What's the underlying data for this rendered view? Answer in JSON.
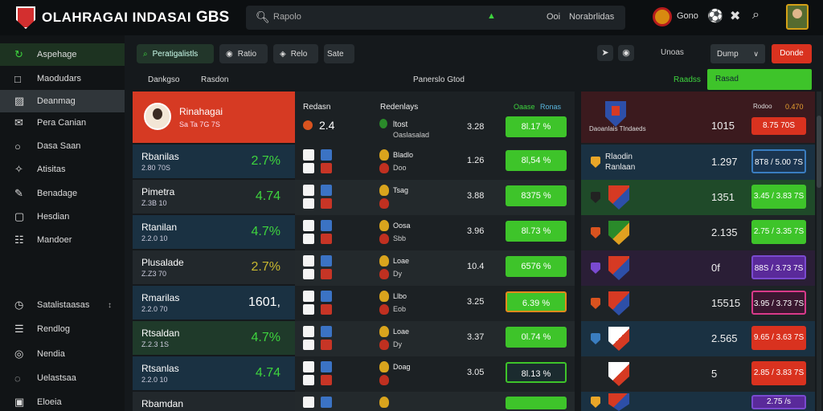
{
  "topbar": {
    "title": "OLAHRAGAI INDASAI",
    "brand_suffix": "GBS",
    "search_placeholder": "Rapolo",
    "search_right_1": "Ooi",
    "search_right_2": "Norabrlidas",
    "game_label": "Gono"
  },
  "sidebar": {
    "items": [
      {
        "label": "Aspehage",
        "icon": "refresh-icon"
      },
      {
        "label": "Maodudars",
        "icon": "square-icon"
      },
      {
        "label": "Deanmag",
        "icon": "image-icon"
      },
      {
        "label": "Pera Canian",
        "icon": "message-icon"
      },
      {
        "label": "Dasa Saan",
        "icon": "chat-icon"
      },
      {
        "label": "Atisitas",
        "icon": "shield-icon"
      },
      {
        "label": "Benadage",
        "icon": "pen-icon"
      },
      {
        "label": "Hesdian",
        "icon": "box-icon"
      },
      {
        "label": "Mandoer",
        "icon": "grid-icon"
      },
      {
        "label": "Satalistaasas",
        "icon": "clock-icon"
      },
      {
        "label": "Rendlog",
        "icon": "list-icon"
      },
      {
        "label": "Nendia",
        "icon": "target-icon"
      },
      {
        "label": "Uelastsaa",
        "icon": "globe-icon"
      },
      {
        "label": "Eloeia",
        "icon": "square-icon"
      }
    ]
  },
  "toolbar": {
    "filter1": "Peratigalistls",
    "filter2": "Ratio",
    "filter3": "Relo",
    "filter4": "Sate",
    "mark": "Unoas",
    "dropdown": "Dump",
    "red_button": "Donde",
    "col_a": "Dankgso",
    "col_b": "Rasdon",
    "col_c": "Panerslo Gtod",
    "green_label": "Raadss",
    "green_bar": "Rasad"
  },
  "players": {
    "header": {
      "name": "Rinahagai",
      "sub": "Sa Ta 7G 7S"
    },
    "rows": [
      {
        "name": "Rbanilas",
        "sub": "2.80 70S",
        "val": "2.7%",
        "style": "g"
      },
      {
        "name": "Pimetra",
        "sub": "Z.3B 10",
        "val": "4.74",
        "style": "g"
      },
      {
        "name": "Rtanilan",
        "sub": "2.2.0 10",
        "val": "4.7%",
        "style": "g"
      },
      {
        "name": "Plusalade",
        "sub": "Z.Z3 70",
        "val": "2.7%",
        "style": "y"
      },
      {
        "name": "Rmarilas",
        "sub": "2.2.0 70",
        "val": "1601,",
        "style": "w"
      },
      {
        "name": "Rtsaldan",
        "sub": "Z.2.3 1S",
        "val": "4.7%",
        "style": "g"
      },
      {
        "name": "Rtsanlas",
        "sub": "2.2.0 10",
        "val": "4.74",
        "style": "g"
      },
      {
        "name": "Rbamdan",
        "sub": "",
        "val": "",
        "style": "w"
      }
    ]
  },
  "matches": {
    "header": {
      "col1": "Redasn",
      "col2": "Redenlays",
      "tag1": "Oaase",
      "tag2": "Ronas",
      "score": "2.4",
      "opp1": "ltost",
      "opp2": "Oaslasalad",
      "num": "3.28",
      "odd": "8l.17 %"
    },
    "rows": [
      {
        "t1": "Bladlo",
        "t2": "Doo",
        "num": "1.26",
        "odd": "8l,54 %",
        "style": ""
      },
      {
        "t1": "Tsag",
        "t2": "",
        "num": "3.88",
        "odd": "8375 %",
        "style": ""
      },
      {
        "t1": "Oosa",
        "t2": "Sbb",
        "num": "3.96",
        "odd": "8l.73 %",
        "style": ""
      },
      {
        "t1": "Loae",
        "t2": "Dy",
        "num": "10.4",
        "odd": "6576 %",
        "style": ""
      },
      {
        "t1": "Llbo",
        "t2": "Eob",
        "num": "3.25",
        "odd": "6.39 %",
        "style": "orange"
      },
      {
        "t1": "Loae",
        "t2": "Dy",
        "num": "3.37",
        "odd": "0l.74 %",
        "style": ""
      },
      {
        "t1": "Doag",
        "t2": "",
        "num": "3.05",
        "odd": "8l.13 %",
        "style": "dark"
      },
      {
        "t1": "",
        "t2": "",
        "num": "",
        "odd": "",
        "style": ""
      }
    ]
  },
  "odds": {
    "header": {
      "tr1": "Rodoo",
      "tr2": "0.470",
      "label": "Daoanlais Tlndaeds",
      "num": "1015",
      "box": "8.75 70S"
    },
    "rows": [
      {
        "t1": "Rlaodin",
        "t2": "Ranlaan",
        "num": "1.297",
        "box": "8T8 / 5.00 7S",
        "style": "blue"
      },
      {
        "t1": "",
        "t2": "",
        "num": "1351",
        "box": "3.45 / 3.83 7S",
        "style": "green"
      },
      {
        "t1": "",
        "t2": "",
        "num": "2.135",
        "box": "2.75 / 3.35 7S",
        "style": "green"
      },
      {
        "t1": "",
        "t2": "",
        "num": "0f",
        "box": "88S / 3.73 7S",
        "style": "purple"
      },
      {
        "t1": "",
        "t2": "",
        "num": "15515",
        "box": "3.95 / 3.73 7S",
        "style": "maroon"
      },
      {
        "t1": "",
        "t2": "",
        "num": "2.565",
        "box": "9.65 / 3.63 7S",
        "style": "red"
      },
      {
        "t1": "",
        "t2": "",
        "num": "5",
        "box": "2.85 / 3.83 7S",
        "style": "red"
      },
      {
        "t1": "",
        "t2": "",
        "num": "",
        "box": "2.75 /s",
        "style": "purple"
      }
    ]
  },
  "colors": {
    "accent_green": "#3ec42a",
    "accent_red": "#d9321f",
    "panel_blue": "#1a3142",
    "panel_green": "#1f4a29"
  }
}
